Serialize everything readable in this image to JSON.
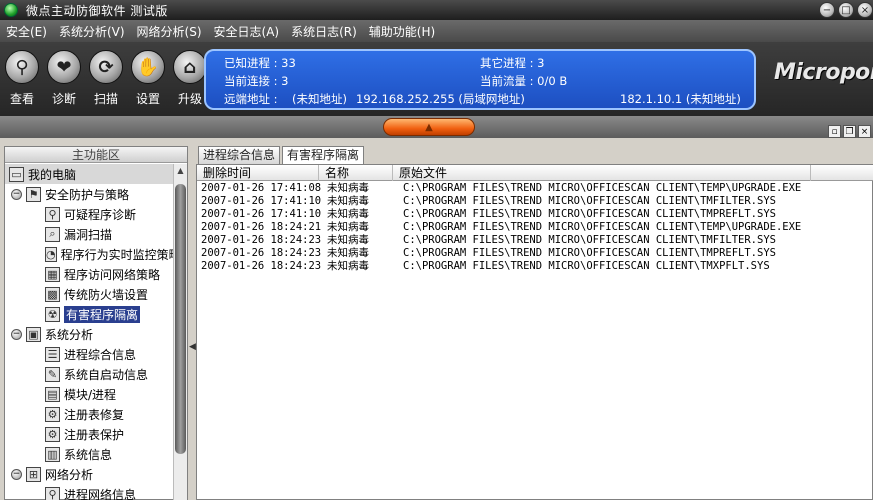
{
  "window": {
    "title": "微点主动防御软件  测试版"
  },
  "menu": [
    "安全(E)",
    "系统分析(V)",
    "网络分析(S)",
    "安全日志(A)",
    "系统日志(R)",
    "辅助功能(H)"
  ],
  "toolbar": [
    {
      "label": "查看",
      "icon": "view-magnifier-icon",
      "glyph": "⚲"
    },
    {
      "label": "诊断",
      "icon": "diagnose-heart-icon",
      "glyph": "❤"
    },
    {
      "label": "扫描",
      "icon": "scan-icon",
      "glyph": "⟳"
    },
    {
      "label": "设置",
      "icon": "settings-hand-icon",
      "glyph": "✋"
    },
    {
      "label": "升级",
      "icon": "upgrade-house-icon",
      "glyph": "⌂"
    }
  ],
  "info": {
    "known_processes": "已知进程 : 33",
    "other_processes": "其它进程 : 3",
    "current_connections": "当前连接 : 3",
    "current_traffic": "当前流量 : 0/0 B",
    "remote_label": "远端地址 : ",
    "remote_unknown": "(未知地址)",
    "remote_lan": "192.168.252.255 (局域网地址)",
    "remote_unknown2": "182.1.10.1 (未知地址)"
  },
  "logo": "Micropoint",
  "left_panel": {
    "title": "主功能区",
    "items": [
      {
        "label": "我的电脑",
        "level": 0,
        "icon": "computer-icon",
        "glyph": "▭",
        "root": true
      },
      {
        "label": "安全防护与策略",
        "level": 1,
        "expander": "−",
        "icon": "shield-policy-icon",
        "glyph": "⚑"
      },
      {
        "label": "可疑程序诊断",
        "level": 2,
        "icon": "suspicious-program-icon",
        "glyph": "⚲"
      },
      {
        "label": "漏洞扫描",
        "level": 2,
        "icon": "vulnerability-scan-icon",
        "glyph": "⌕"
      },
      {
        "label": "程序行为实时监控策略",
        "level": 2,
        "icon": "behavior-monitor-icon",
        "glyph": "◔"
      },
      {
        "label": "程序访问网络策略",
        "level": 2,
        "icon": "network-policy-icon",
        "glyph": "▦"
      },
      {
        "label": "传统防火墙设置",
        "level": 2,
        "icon": "firewall-icon",
        "glyph": "▩"
      },
      {
        "label": "有害程序隔离",
        "level": 2,
        "icon": "quarantine-icon",
        "glyph": "☢",
        "selected": true
      },
      {
        "label": "系统分析",
        "level": 1,
        "expander": "−",
        "icon": "system-analysis-icon",
        "glyph": "▣"
      },
      {
        "label": "进程综合信息",
        "level": 2,
        "icon": "process-info-icon",
        "glyph": "☰"
      },
      {
        "label": "系统自启动信息",
        "level": 2,
        "icon": "autostart-icon",
        "glyph": "✎"
      },
      {
        "label": "模块/进程",
        "level": 2,
        "icon": "module-process-icon",
        "glyph": "▤"
      },
      {
        "label": "注册表修复",
        "level": 2,
        "icon": "registry-repair-icon",
        "glyph": "⚙"
      },
      {
        "label": "注册表保护",
        "level": 2,
        "icon": "registry-protect-icon",
        "glyph": "⚙"
      },
      {
        "label": "系统信息",
        "level": 2,
        "icon": "system-info-icon",
        "glyph": "▥"
      },
      {
        "label": "网络分析",
        "level": 1,
        "expander": "−",
        "icon": "network-analysis-icon",
        "glyph": "⊞"
      },
      {
        "label": "进程网络信息",
        "level": 2,
        "icon": "process-network-icon",
        "glyph": "⚲"
      }
    ]
  },
  "tabs": [
    {
      "label": "进程综合信息",
      "active": false
    },
    {
      "label": "有害程序隔离",
      "active": true
    }
  ],
  "table": {
    "columns": [
      "删除时间",
      "名称",
      "原始文件"
    ],
    "rows": [
      [
        "2007-01-26 17:41:08",
        "未知病毒",
        "C:\\PROGRAM FILES\\TREND MICRO\\OFFICESCAN CLIENT\\TEMP\\UPGRADE.EXE"
      ],
      [
        "2007-01-26 17:41:10",
        "未知病毒",
        "C:\\PROGRAM FILES\\TREND MICRO\\OFFICESCAN CLIENT\\TMFILTER.SYS"
      ],
      [
        "2007-01-26 17:41:10",
        "未知病毒",
        "C:\\PROGRAM FILES\\TREND MICRO\\OFFICESCAN CLIENT\\TMPREFLT.SYS"
      ],
      [
        "2007-01-26 18:24:21",
        "未知病毒",
        "C:\\PROGRAM FILES\\TREND MICRO\\OFFICESCAN CLIENT\\TEMP\\UPGRADE.EXE"
      ],
      [
        "2007-01-26 18:24:23",
        "未知病毒",
        "C:\\PROGRAM FILES\\TREND MICRO\\OFFICESCAN CLIENT\\TMFILTER.SYS"
      ],
      [
        "2007-01-26 18:24:23",
        "未知病毒",
        "C:\\PROGRAM FILES\\TREND MICRO\\OFFICESCAN CLIENT\\TMPREFLT.SYS"
      ],
      [
        "2007-01-26 18:24:23",
        "未知病毒",
        "C:\\PROGRAM FILES\\TREND MICRO\\OFFICESCAN CLIENT\\TMXPFLT.SYS"
      ]
    ]
  }
}
